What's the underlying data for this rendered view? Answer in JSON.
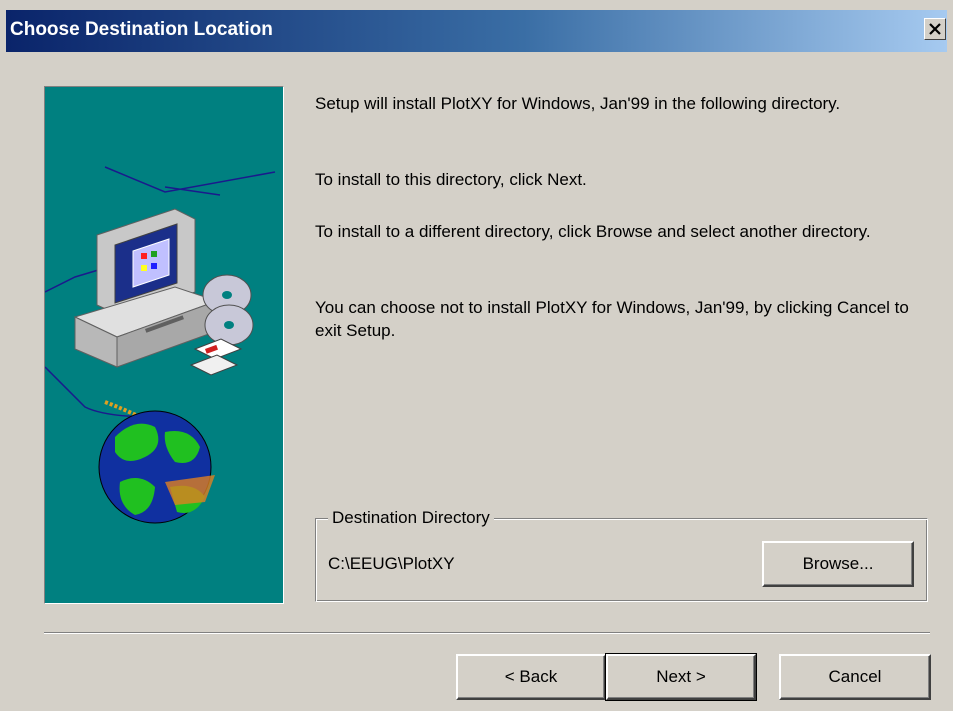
{
  "window": {
    "title": "Choose Destination Location",
    "close_glyph": "×"
  },
  "content": {
    "para1": "Setup will install PlotXY for Windows, Jan'99 in the following directory.",
    "para2": "To install to this directory, click Next.",
    "para3": "To install to a different directory, click Browse and select another directory.",
    "para4": "You can choose not to install PlotXY for Windows, Jan'99, by clicking Cancel to exit Setup."
  },
  "destination": {
    "legend": "Destination Directory",
    "path": "C:\\EEUG\\PlotXY",
    "browse_label": "Browse..."
  },
  "buttons": {
    "back": "< Back",
    "next": "Next >",
    "cancel": "Cancel"
  },
  "icons": {
    "illustration": "computer-globe-illustration",
    "close": "close-icon"
  },
  "colors": {
    "title_start": "#0a246a",
    "title_end": "#a6caf0",
    "illustration_bg": "#008080",
    "dialog_bg": "#d4d0c8"
  }
}
